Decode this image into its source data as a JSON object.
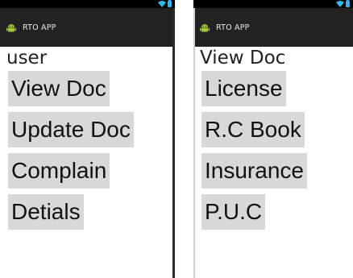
{
  "screens": [
    {
      "app_title": "RTO APP",
      "screen_label": "user",
      "buttons": [
        {
          "label": "View Doc"
        },
        {
          "label": "Update Doc"
        },
        {
          "label": "Complain"
        },
        {
          "label": "Detials"
        }
      ]
    },
    {
      "app_title": "RTO APP",
      "screen_label": "View Doc",
      "buttons": [
        {
          "label": "License"
        },
        {
          "label": "R.C Book"
        },
        {
          "label": "Insurance"
        },
        {
          "label": "P.U.C"
        }
      ]
    }
  ],
  "icons": {
    "app": "android-icon",
    "wifi": "wifi-icon",
    "battery": "battery-icon"
  },
  "colors": {
    "statusbar": "#000000",
    "actionbar": "#222222",
    "button_bg": "#d8d8d8",
    "accent": "#33b5e5",
    "android_green": "#a4c639"
  }
}
